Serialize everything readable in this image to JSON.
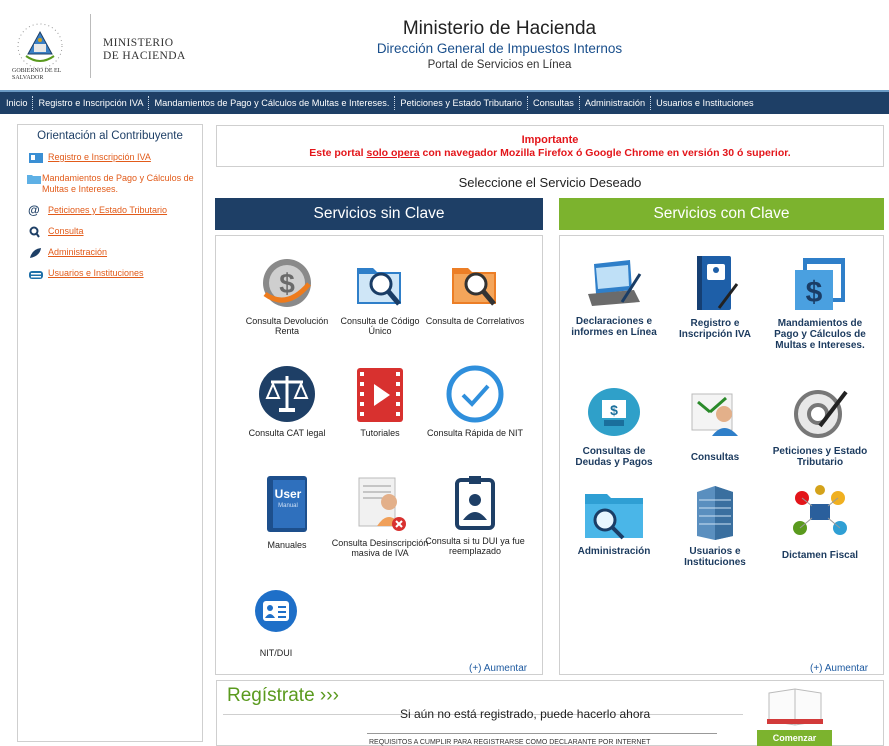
{
  "header": {
    "seal_text": "GOBIERNO DE EL SALVADOR",
    "ministry_line1": "MINISTERIO",
    "ministry_line2": "DE HACIENDA",
    "title": "Ministerio de Hacienda",
    "subtitle": "Dirección General de Impuestos Internos",
    "portal": "Portal de Servicios en Línea"
  },
  "nav": [
    "Inicio",
    "Registro e Inscripción IVA",
    "Mandamientos de Pago y Cálculos de Multas e Intereses.",
    "Peticiones y Estado Tributario",
    "Consultas",
    "Administración",
    "Usuarios e Instituciones"
  ],
  "sidebar": {
    "title": "Orientación al Contribuyente",
    "items": [
      {
        "label": "Registro e Inscripción IVA",
        "icon": "id-card-icon"
      },
      {
        "label": "Mandamientos de Pago y Cálculos de Multas e Intereses.",
        "icon": "folder-icon"
      },
      {
        "label": "Peticiones y Estado Tributario",
        "icon": "at-icon"
      },
      {
        "label": "Consulta",
        "icon": "search-icon"
      },
      {
        "label": "Administración",
        "icon": "leaf-icon"
      },
      {
        "label": "Usuarios e Instituciones",
        "icon": "building-icon"
      }
    ]
  },
  "important": {
    "title": "Importante",
    "msg_pre": "Este portal ",
    "msg_u": "solo opera",
    "msg_post": " con navegador Mozilla Firefox ó Google Chrome en versión 30 ó superior."
  },
  "select_title": "Seleccione el Servicio Deseado",
  "sin_clave": {
    "header": "Servicios sin Clave",
    "tiles": [
      "Consulta Devolución Renta",
      "Consulta de Código Único",
      "Consulta de Correlativos",
      "Consulta CAT legal",
      "Tutoriales",
      "Consulta Rápida de NIT",
      "Manuales",
      "Consulta Desinscripción masiva de IVA",
      "Consulta si tu DUI ya fue reemplazado",
      "NIT/DUI"
    ],
    "user_manual_word": "User",
    "user_manual_sub": "Manual",
    "more": "(+) Aumentar"
  },
  "con_clave": {
    "header": "Servicios con Clave",
    "tiles": [
      "Declaraciones e informes en Línea",
      "Registro e Inscripción IVA",
      "Mandamientos de Pago y Cálculos de Multas e Intereses.",
      "Consultas de Deudas y Pagos",
      "Consultas",
      "Peticiones y Estado Tributario",
      "Administración",
      "Usuarios e Instituciones",
      "Dictamen Fiscal"
    ],
    "more": "(+) Aumentar"
  },
  "registrate": {
    "title": "Regístrate ›››",
    "message": "Si aún no está registrado, puede hacerlo ahora",
    "requirements": "REQUISITOS A CUMPLIR PARA REGISTRARSE COMO DECLARANTE POR INTERNET",
    "button": "Comenzar"
  },
  "colors": {
    "navy": "#1e3f66",
    "green": "#7cb32e",
    "red": "#e3151a",
    "link_orange": "#e25b1a"
  }
}
